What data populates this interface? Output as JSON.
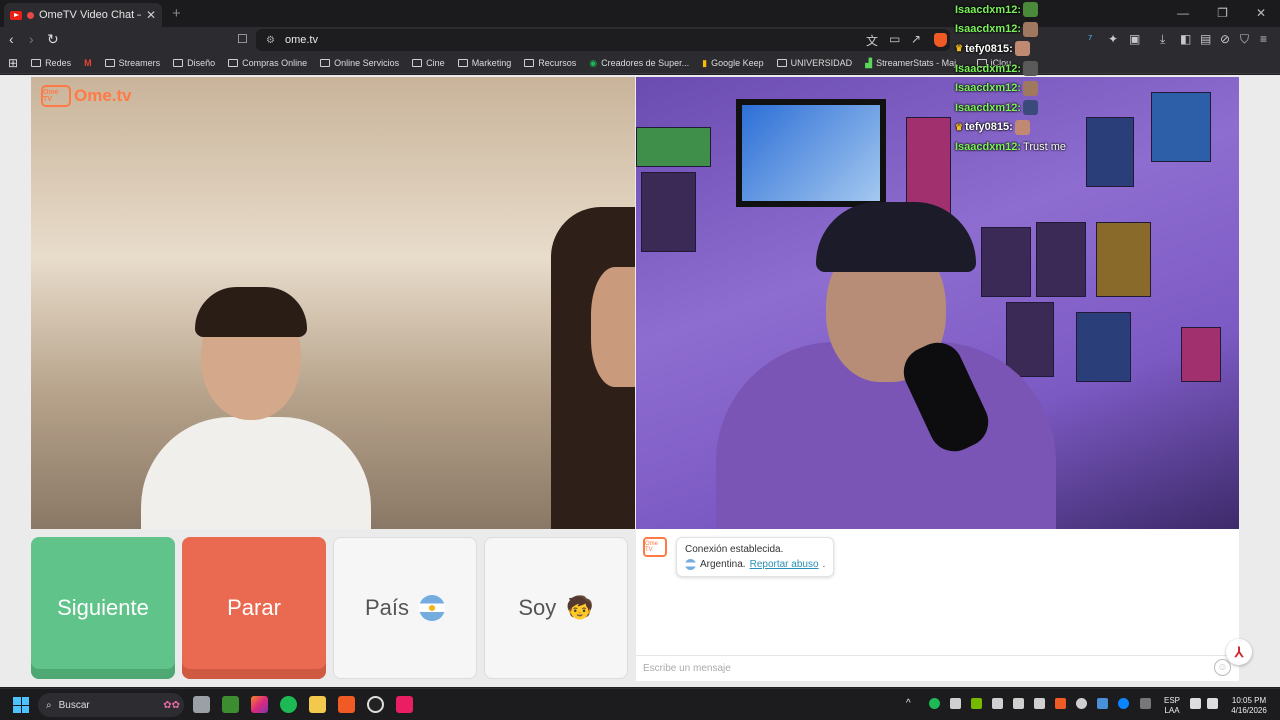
{
  "browser": {
    "tab_title": "OmeTV Video Chat — Omeg",
    "tab_close": "✕",
    "new_tab": "+",
    "url": "ome.tv",
    "window_controls": [
      "—",
      "❐",
      "✕"
    ]
  },
  "bookmarks": [
    {
      "label": "Redes",
      "icon": "folder-icon"
    },
    {
      "label": "",
      "icon": "gmail-icon"
    },
    {
      "label": "Streamers",
      "icon": "folder-icon"
    },
    {
      "label": "Diseño",
      "icon": "folder-icon"
    },
    {
      "label": "Compras Online",
      "icon": "folder-icon"
    },
    {
      "label": "Online Servicios",
      "icon": "folder-icon"
    },
    {
      "label": "Cine",
      "icon": "folder-icon"
    },
    {
      "label": "Marketing",
      "icon": "folder-icon"
    },
    {
      "label": "Recursos",
      "icon": "folder-icon"
    },
    {
      "label": "Creadores de Super...",
      "icon": "bookmark-icon"
    },
    {
      "label": "Google Keep",
      "icon": "keep-icon"
    },
    {
      "label": "UNIVERSIDAD",
      "icon": "folder-icon"
    },
    {
      "label": "StreamerStats - Maj...",
      "icon": "stats-icon"
    },
    {
      "label": "iClou",
      "icon": "folder-icon"
    }
  ],
  "ometv": {
    "logo_text": "Ome.tv",
    "logo_tv_text": "Ome TV",
    "buttons": {
      "next": "Siguiente",
      "stop": "Parar",
      "country": "País",
      "soy": "Soy",
      "soy_emoji": "🧒"
    },
    "chat": {
      "system_line1": "Conexión establecida.",
      "country_name": "Argentina.",
      "report_link": "Reportar abuso",
      "report_suffix": ".",
      "input_placeholder": "Escribe un mensaje",
      "emoji_glyph": "☺"
    }
  },
  "stream_overlay": [
    {
      "user": "Isaacdxm12:",
      "vip": false,
      "message": ""
    },
    {
      "user": "Isaacdxm12:",
      "vip": false,
      "message": ""
    },
    {
      "user": "tefy0815:",
      "vip": true,
      "message": ""
    },
    {
      "user": "Isaacdxm12:",
      "vip": false,
      "message": ""
    },
    {
      "user": "Isaacdxm12:",
      "vip": false,
      "message": ""
    },
    {
      "user": "Isaacdxm12:",
      "vip": false,
      "message": ""
    },
    {
      "user": "tefy0815:",
      "vip": true,
      "message": ""
    },
    {
      "user": "Isaacdxm12:",
      "vip": false,
      "message": "Trust me"
    }
  ],
  "taskbar": {
    "search_placeholder": "Buscar",
    "lang_top": "ESP",
    "lang_bottom": "LAA",
    "time": "10:05 PM",
    "date": "4/16/2026"
  },
  "colors": {
    "next_green": "#5fc38a",
    "stop_red": "#e96a50",
    "ome_orange": "#ff7a45",
    "link_blue": "#2a8fb5",
    "overlay_green": "#7cf25a"
  }
}
